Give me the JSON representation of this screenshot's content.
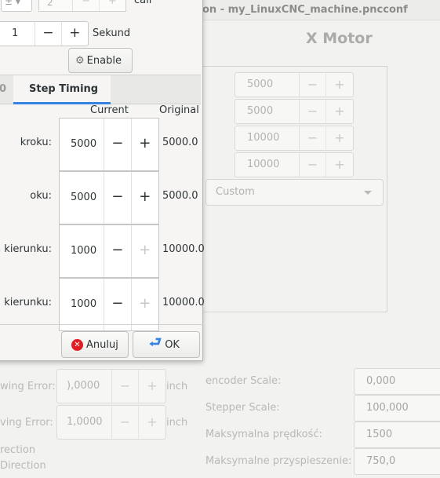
{
  "background": {
    "title": "on - my_LinuxCNC_machine.pncconf",
    "motor_title": "X Motor",
    "timing_values": [
      "5000",
      "5000",
      "10000",
      "10000"
    ],
    "combo_value": "Custom",
    "following_error_rows": [
      {
        "label": "wing Error:",
        "value": "),0000",
        "unit": "inch"
      },
      {
        "label": "ving Error:",
        "value": "1,0000",
        "unit": "inch"
      }
    ],
    "direction_labels": [
      "rection",
      "Direction"
    ],
    "scale_rows": [
      {
        "label": "encoder Scale:",
        "value": "0,000"
      },
      {
        "label": "Stepper Scale:",
        "value": "100,000"
      },
      {
        "label": "Maksymalna prędkość:",
        "value": "1500"
      },
      {
        "label": "Maksymalne przyspieszenie:",
        "value": "750,0"
      }
    ]
  },
  "dialog": {
    "top_row": {
      "combo": "±",
      "spin_value": "2",
      "label": "call"
    },
    "seconds": {
      "value": "1",
      "label": "Sekund"
    },
    "enable_label": "Enable",
    "tabs": {
      "previous_partial": "0",
      "active": "Step Timing"
    },
    "headers": {
      "current": "Current",
      "original": "Original"
    },
    "params": [
      {
        "label": "kroku:",
        "current": "5000",
        "original": "5000.0",
        "plus_enabled": true
      },
      {
        "label": "oku:",
        "current": "5000",
        "original": "5000.0",
        "plus_enabled": true
      },
      {
        "label": "a kierunku:",
        "current": "1000",
        "original": "10000.0",
        "plus_enabled": false
      },
      {
        "label": "kierunku:",
        "current": "1000",
        "original": "10000.0",
        "plus_enabled": false
      }
    ],
    "cancel_label": "Anuluj",
    "ok_label": "OK"
  },
  "glyphs": {
    "minus": "−",
    "plus": "+"
  }
}
